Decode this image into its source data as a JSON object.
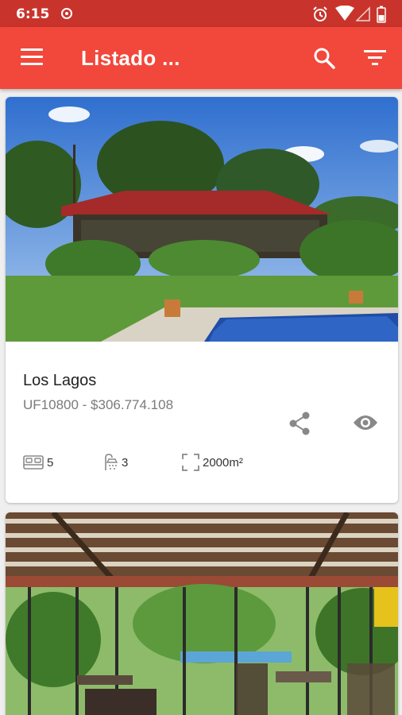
{
  "status_bar": {
    "time": "6:15",
    "icons": [
      "record-icon",
      "alarm-icon",
      "wifi-icon",
      "signal-icon",
      "battery-icon"
    ]
  },
  "app_bar": {
    "title": "Listado ...",
    "icons": [
      "menu-icon",
      "search-icon",
      "filter-icon"
    ],
    "color": "#f2473b",
    "status_color": "#c8342b"
  },
  "listings": [
    {
      "name": "Los Lagos",
      "price": "UF10800 - $306.774.108",
      "bedrooms": "5",
      "bathrooms": "3",
      "area": "2000m²",
      "actions": [
        "share-icon",
        "eye-icon"
      ]
    },
    {
      "name": "",
      "price": ""
    }
  ]
}
